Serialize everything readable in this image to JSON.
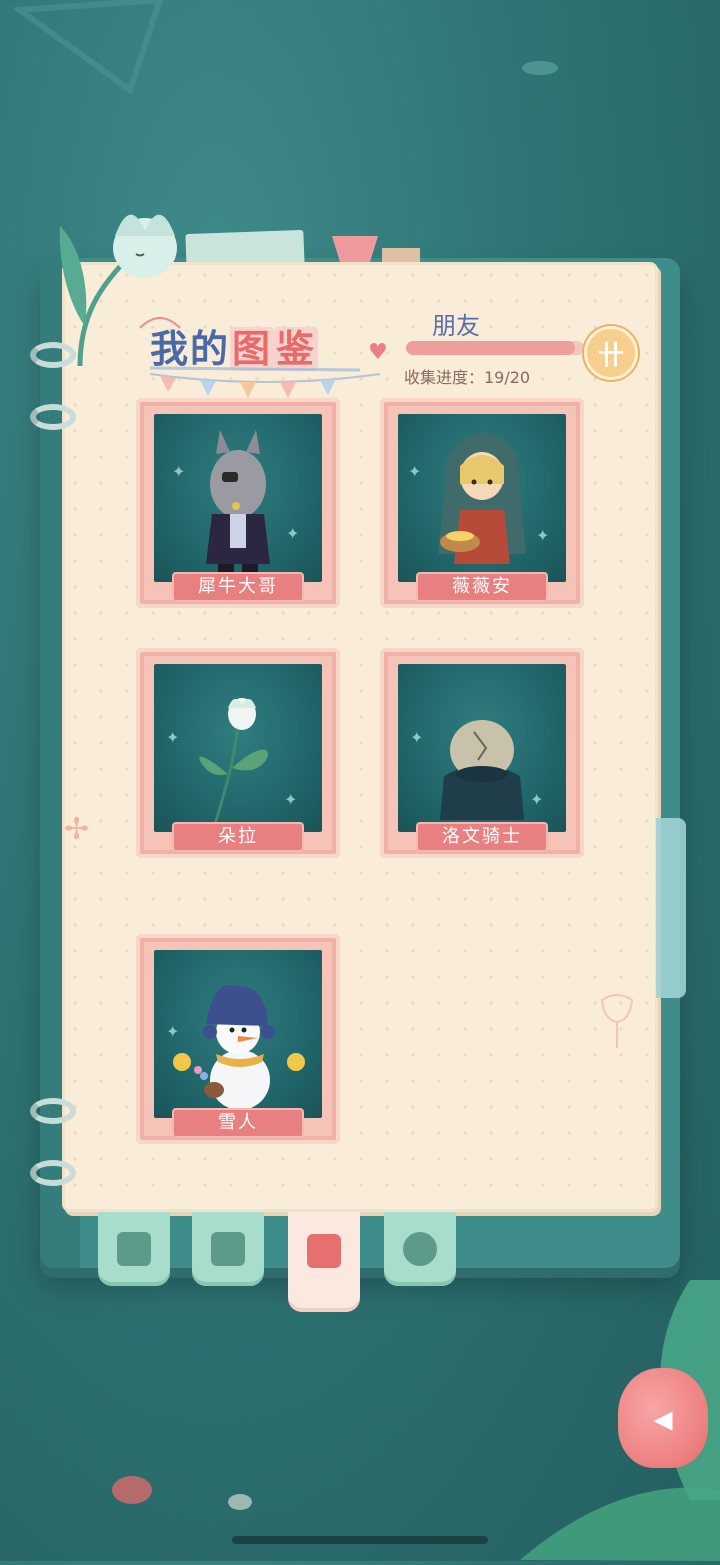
{
  "header": {
    "title_part1": "我的",
    "title_highlight1": "图",
    "title_highlight2": "鉴",
    "category_label": "朋友",
    "progress_label": "收集进度：19/20",
    "progress_fraction": 0.95
  },
  "cards": [
    {
      "name": "犀牛大哥",
      "icon": "rhino-character"
    },
    {
      "name": "薇薇安",
      "icon": "hooded-girl-character"
    },
    {
      "name": "朵拉",
      "icon": "flower-character"
    },
    {
      "name": "洛文骑士",
      "icon": "knight-character"
    },
    {
      "name": "雪人",
      "icon": "snowman-character"
    }
  ],
  "tabs": [
    {
      "icon": "notebook-pen-icon",
      "active": false
    },
    {
      "icon": "journal-icon",
      "active": false
    },
    {
      "icon": "book-star-icon",
      "active": true
    },
    {
      "icon": "flower-icon",
      "active": false
    }
  ],
  "colors": {
    "background": "#2f7474",
    "page": "#f9ecd8",
    "accent_pink": "#e87f80",
    "title_blue": "#4a6aa6",
    "tab_green": "#a8dccb"
  }
}
